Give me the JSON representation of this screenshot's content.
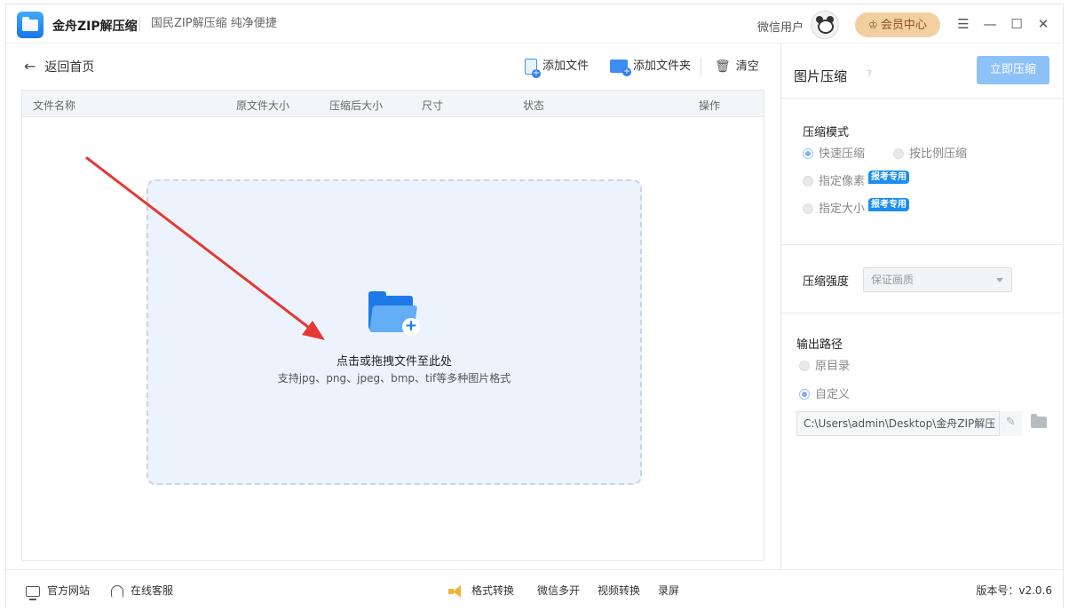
{
  "window": {
    "app_name": "金舟ZIP解压缩",
    "slogan": "国民ZIP解压缩  纯净便捷",
    "user_name": "微信用户",
    "vip_label": "会员中心",
    "controls": {
      "menu": "☰",
      "minimize": "—",
      "maximize": "☐",
      "close": "✕"
    }
  },
  "toolbar": {
    "back_label": "返回首页",
    "back_arrow": "←",
    "add_file": "添加文件",
    "add_folder": "添加文件夹",
    "clear": "清空"
  },
  "table": {
    "columns": [
      "文件名称",
      "原文件大小",
      "压缩后大小",
      "尺寸",
      "状态",
      "操作"
    ]
  },
  "dropzone": {
    "title": "点击或拖拽文件至此处",
    "subtitle": "支持jpg、png、jpeg、bmp、tif等多种图片格式",
    "plus": "+"
  },
  "side": {
    "title": "图片压缩",
    "help": "?",
    "compress_button": "立即压缩",
    "mode": {
      "label": "压缩模式",
      "options": [
        "快速压缩",
        "按比例压缩",
        "指定像素",
        "指定大小"
      ],
      "selected": "快速压缩",
      "badge": "报考专用"
    },
    "strength": {
      "label": "压缩强度",
      "value": "保证画质"
    },
    "output": {
      "label": "输出路径",
      "options": [
        "原目录",
        "自定义"
      ],
      "selected": "自定义",
      "path": "C:\\Users\\admin\\Desktop\\金舟ZIP解压",
      "edit_icon": "✎"
    }
  },
  "footer": {
    "website": "官方网站",
    "support": "在线客服",
    "links": [
      "格式转换",
      "微信多开",
      "视频转换",
      "录屏"
    ],
    "version": "版本号：v2.0.6"
  },
  "colors": {
    "accent": "#1e7ae6",
    "button_disabled": "#8cc2f7",
    "vip": "#f2cfa1",
    "dropzone_bg": "#edf3fd",
    "annotation_arrow": "#e53935"
  }
}
